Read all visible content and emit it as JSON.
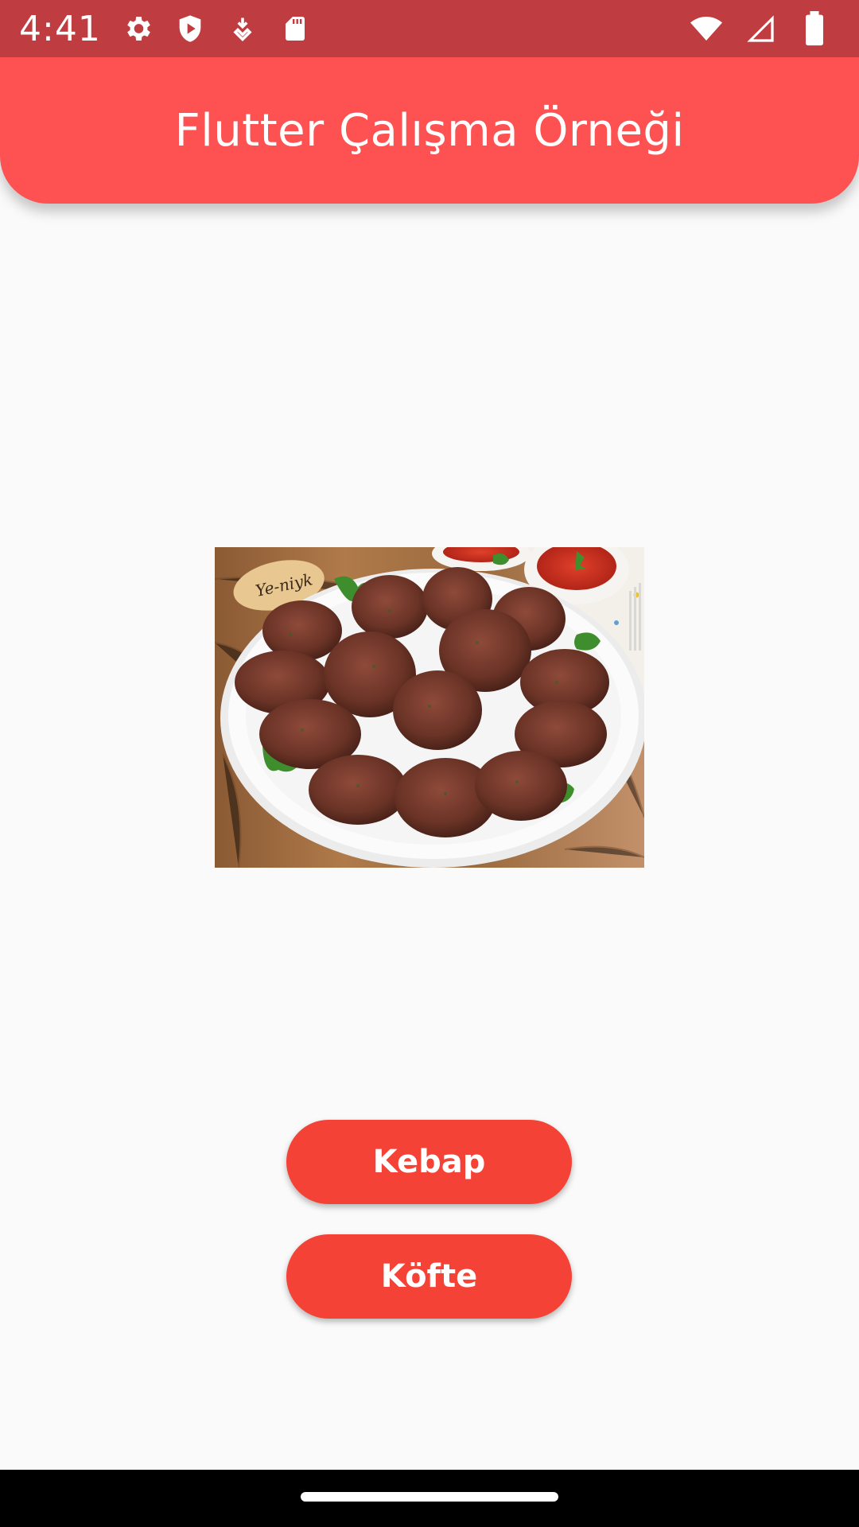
{
  "status_bar": {
    "time": "4:41",
    "left_icons": [
      "gear-icon",
      "shield-play-icon",
      "download-arrow-icon",
      "sd-card-icon"
    ],
    "right_icons": [
      "wifi-icon",
      "signal-icon",
      "battery-icon"
    ],
    "background": "#bf3d40"
  },
  "app_bar": {
    "title": "Flutter Çalışma Örneği",
    "background": "#fd5152"
  },
  "main": {
    "image": {
      "subject": "plate of köfte meatballs with parsley and tomato sauce",
      "sign_text": "Ye-niyk"
    },
    "buttons": [
      {
        "label": "Kebap"
      },
      {
        "label": "Köfte"
      }
    ],
    "button_color": "#f44336"
  },
  "nav_bar": {
    "background": "#000000"
  }
}
